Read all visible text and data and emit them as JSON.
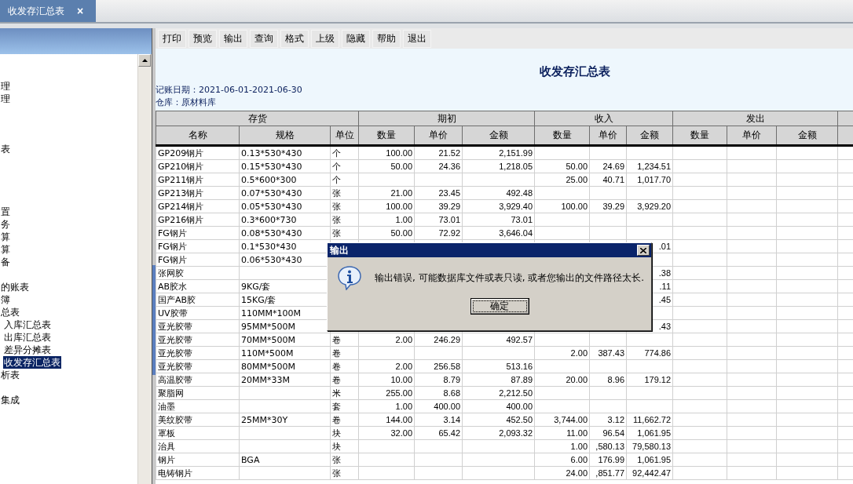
{
  "tab": {
    "label": "收发存汇总表",
    "close": "×"
  },
  "sidebar": {
    "groups": [
      [
        {
          "label": "理",
          "selected": false
        },
        {
          "label": "理",
          "selected": false
        }
      ],
      [
        {
          "label": "表",
          "selected": false
        }
      ],
      [
        {
          "label": "置",
          "selected": false
        },
        {
          "label": "务",
          "selected": false
        },
        {
          "label": "算",
          "selected": false
        },
        {
          "label": "算",
          "selected": false
        },
        {
          "label": "备",
          "selected": false
        }
      ],
      [
        {
          "label": "的账表",
          "selected": false
        },
        {
          "label": "簿",
          "selected": false
        },
        {
          "label": "总表",
          "selected": false,
          "children": [
            {
              "label": "入库汇总表",
              "selected": false
            },
            {
              "label": "出库汇总表",
              "selected": false
            },
            {
              "label": "差异分摊表",
              "selected": false
            },
            {
              "label": "收发存汇总表",
              "selected": true
            }
          ]
        },
        {
          "label": "析表",
          "selected": false
        }
      ],
      [
        {
          "label": "集成",
          "selected": false
        }
      ]
    ]
  },
  "toolbar": [
    "打印",
    "预览",
    "输出",
    "查询",
    "格式",
    "上级",
    "隐藏",
    "帮助",
    "退出"
  ],
  "report": {
    "title": "收发存汇总表",
    "date_line": "记账日期：2021-06-01-2021-06-30",
    "warehouse_line": "仓库：原材料库"
  },
  "table": {
    "groups": [
      {
        "label": "存货",
        "columns": [
          "名称",
          "规格",
          "单位"
        ]
      },
      {
        "label": "期初",
        "columns": [
          "数量",
          "单价",
          "金额"
        ]
      },
      {
        "label": "收入",
        "columns": [
          "数量",
          "单价",
          "金额"
        ]
      },
      {
        "label": "发出",
        "columns": [
          "数量",
          "单价",
          "金额"
        ]
      }
    ],
    "rows": [
      {
        "name": "GP209钢片",
        "spec": "0.13*530*430",
        "unit": "个",
        "open_qty": "100.00",
        "open_price": "21.52",
        "open_amount": "2,151.99"
      },
      {
        "name": "GP210钢片",
        "spec": "0.15*530*430",
        "unit": "个",
        "open_qty": "50.00",
        "open_price": "24.36",
        "open_amount": "1,218.05",
        "in_qty": "50.00",
        "in_price": "24.69",
        "in_amount": "1,234.51"
      },
      {
        "name": "GP211钢片",
        "spec": "0.5*600*300",
        "unit": "个",
        "in_qty": "25.00",
        "in_price": "40.71",
        "in_amount": "1,017.70"
      },
      {
        "name": "GP213钢片",
        "spec": "0.07*530*430",
        "unit": "张",
        "open_qty": "21.00",
        "open_price": "23.45",
        "open_amount": "492.48"
      },
      {
        "name": "GP214钢片",
        "spec": "0.05*530*430",
        "unit": "张",
        "open_qty": "100.00",
        "open_price": "39.29",
        "open_amount": "3,929.40",
        "in_qty": "100.00",
        "in_price": "39.29",
        "in_amount": "3,929.20"
      },
      {
        "name": "GP216钢片",
        "spec": "0.3*600*730",
        "unit": "张",
        "open_qty": "1.00",
        "open_price": "73.01",
        "open_amount": "73.01"
      },
      {
        "name": "FG钢片",
        "spec": "0.08*530*430",
        "unit": "张",
        "open_qty": "50.00",
        "open_price": "72.92",
        "open_amount": "3,646.04"
      },
      {
        "name": "FG钢片",
        "spec": "0.1*530*430",
        "in_amount": ".01"
      },
      {
        "name": "FG钢片",
        "spec": "0.06*530*430"
      },
      {
        "name": "张网胶",
        "in_amount": ".38"
      },
      {
        "name": "AB胶水",
        "spec": "9KG/套",
        "in_amount": ".11"
      },
      {
        "name": "国产AB胶",
        "spec": "15KG/套",
        "in_amount": ".45"
      },
      {
        "name": "UV胶带",
        "spec": "110MM*100M"
      },
      {
        "name": "亚光胶带",
        "spec": "95MM*500M",
        "in_amount": ".43"
      },
      {
        "name": "亚光胶带",
        "spec": "70MM*500M",
        "unit": "卷",
        "open_qty": "2.00",
        "open_price": "246.29",
        "open_amount": "492.57"
      },
      {
        "name": "亚光胶带",
        "spec": "110M*500M",
        "unit": "卷",
        "in_qty": "2.00",
        "in_price": "387.43",
        "in_amount": "774.86"
      },
      {
        "name": "亚光胶带",
        "spec": "80MM*500M",
        "unit": "卷",
        "open_qty": "2.00",
        "open_price": "256.58",
        "open_amount": "513.16"
      },
      {
        "name": "高温胶带",
        "spec": "20MM*33M",
        "unit": "卷",
        "open_qty": "10.00",
        "open_price": "8.79",
        "open_amount": "87.89",
        "in_qty": "20.00",
        "in_price": "8.96",
        "in_amount": "179.12"
      },
      {
        "name": "聚脂网",
        "unit": "米",
        "open_qty": "255.00",
        "open_price": "8.68",
        "open_amount": "2,212.50"
      },
      {
        "name": "油墨",
        "unit": "套",
        "open_qty": "1.00",
        "open_price": "400.00",
        "open_amount": "400.00"
      },
      {
        "name": "美纹胶带",
        "spec": "25MM*30Y",
        "unit": "卷",
        "open_qty": "144.00",
        "open_price": "3.14",
        "open_amount": "452.50",
        "in_qty": "3,744.00",
        "in_price": "3.12",
        "in_amount": "11,662.72"
      },
      {
        "name": "罩板",
        "unit": "块",
        "open_qty": "32.00",
        "open_price": "65.42",
        "open_amount": "2,093.32",
        "in_qty": "11.00",
        "in_price": "96.54",
        "in_amount": "1,061.95"
      },
      {
        "name": "治具",
        "unit": "块",
        "in_qty": "1.00",
        "in_price": ",580.13",
        "in_amount": "79,580.13"
      },
      {
        "name": "钢片",
        "spec": "BGA",
        "unit": "张",
        "in_qty": "6.00",
        "in_price": "176.99",
        "in_amount": "1,061.95"
      },
      {
        "name": "电铸钢片",
        "unit": "张",
        "in_qty": "24.00",
        "in_price": ",851.77",
        "in_amount": "92,442.47"
      }
    ]
  },
  "dialog": {
    "title": "输出",
    "message": "输出错误, 可能数据库文件或表只读, 或者您输出的文件路径太长.",
    "ok_button": "确定"
  }
}
